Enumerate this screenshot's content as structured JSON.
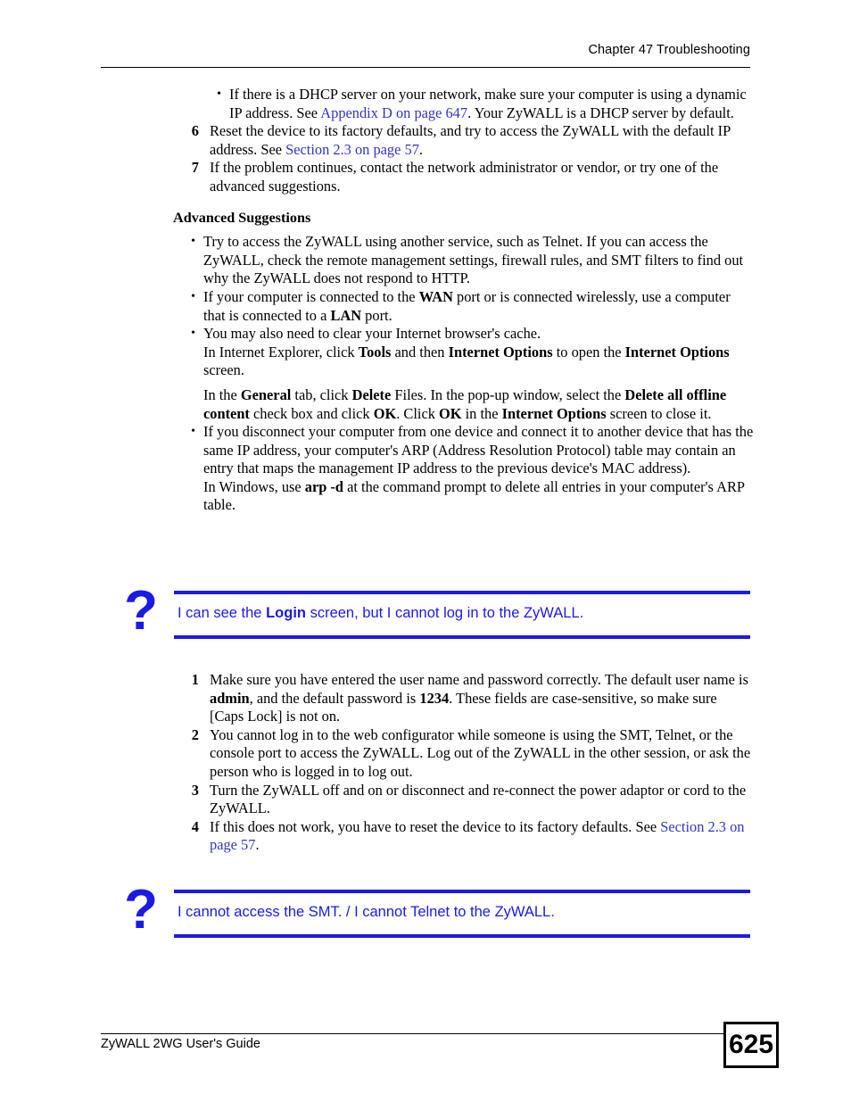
{
  "header": {
    "chapter_title": "Chapter 47 Troubleshooting"
  },
  "footer": {
    "guide_title": "ZyWALL 2WG User's Guide",
    "page_number": "625"
  },
  "colors": {
    "link_blue": "#3333cc",
    "callout_blue": "#1a1ae6",
    "text_black": "#000000"
  },
  "continued_list": {
    "bullet_marker": "•",
    "dhcp_bullet": {
      "part1": "If there is a DHCP server on your network, make sure your computer is using a dynamic IP address. See ",
      "link": "Appendix D on page 647",
      "part2": ". Your ZyWALL is a DHCP server by default."
    },
    "steps": [
      {
        "number": "6",
        "part1": "Reset the device to its factory defaults, and try to access the ZyWALL with the default IP address. See ",
        "link": "Section 2.3 on page 57",
        "part2": "."
      },
      {
        "number": "7",
        "part1": "If the problem continues, contact the network administrator or vendor, or try one of the advanced suggestions.",
        "link": "",
        "part2": ""
      }
    ]
  },
  "advanced_suggestions": {
    "heading": "Advanced Suggestions",
    "bullet_marker": "•",
    "items": [
      {
        "text_a": "Try to access the ZyWALL using another service, such as Telnet. If you can access the ZyWALL, check the remote management settings, firewall rules, and SMT filters to find out why the ZyWALL does not respond to HTTP."
      },
      {
        "text_a": "If your computer is connected to the ",
        "bold_a": "WAN",
        "text_b": " port or is connected wirelessly, use a computer that is connected to a ",
        "bold_b": "LAN",
        "text_c": " port."
      },
      {
        "text_a": "You may also need to clear your Internet browser's cache."
      },
      {
        "text_a": "If you disconnect your computer from one device and connect it to another device that has the same IP address, your computer's ARP (Address Resolution Protocol) table may contain an entry that maps the management IP address to the previous device's MAC address)."
      }
    ],
    "ie_paragraph": {
      "p1": "In Internet Explorer, click ",
      "b1": "Tools",
      "p2": " and then ",
      "b2": "Internet Options",
      "p3": " to open the ",
      "b3": "Internet Options",
      "p4": " screen."
    },
    "general_paragraph": {
      "p1": "In the ",
      "b1": "General",
      "p2": " tab, click ",
      "b2": "Delete",
      "p3": " Files. In the pop-up window, select the ",
      "b3": "Delete all offline content",
      "p4": " check box and click ",
      "b4": "OK",
      "p5": ". Click ",
      "b5": "OK",
      "p6": " in the ",
      "b6": "Internet Options",
      "p7": " screen to close it."
    },
    "windows_paragraph": {
      "p1": "In Windows, use ",
      "b1": "arp -d",
      "p2": " at the command prompt to delete all entries in your computer's ARP table."
    }
  },
  "callout_1": {
    "icon": "question-mark",
    "text_a": "I can see the ",
    "bold": "Login",
    "text_b": " screen, but I cannot log in to the ZyWALL.",
    "steps": [
      {
        "number": "1",
        "p1": "Make sure you have entered the user name and password correctly. The default user name is ",
        "b1": "admin",
        "p2": ", and the default password is ",
        "b2": "1234",
        "p3": ". These fields are case-sensitive, so make sure [Caps Lock] is not on."
      },
      {
        "number": "2",
        "p1": "You cannot log in to the web configurator while someone is using the SMT, Telnet, or the console port to access the ZyWALL. Log out of the ZyWALL in the other session, or ask the person who is logged in to log out.",
        "b1": "",
        "p2": "",
        "b2": "",
        "p3": ""
      },
      {
        "number": "3",
        "p1": "Turn the ZyWALL off and on or disconnect and re-connect the power adaptor or cord to the ZyWALL.",
        "b1": "",
        "p2": "",
        "b2": "",
        "p3": ""
      },
      {
        "number": "4",
        "p1": "If this does not work, you have to reset the device to its factory defaults. See ",
        "link": "Section 2.3 on page 57",
        "p3": "."
      }
    ]
  },
  "callout_2": {
    "icon": "question-mark",
    "text_a": "I cannot access the SMT. / I cannot Telnet to the ZyWALL."
  }
}
